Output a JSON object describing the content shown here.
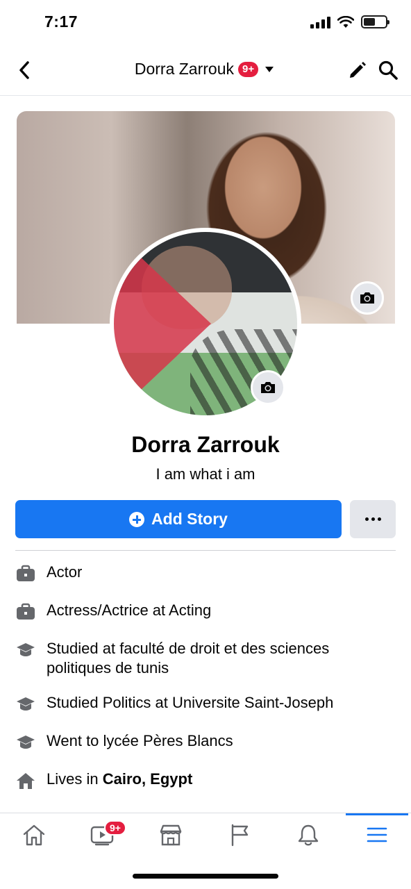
{
  "status_bar": {
    "time": "7:17"
  },
  "header": {
    "title": "Dorra Zarrouk",
    "badge": "9+"
  },
  "profile": {
    "name": "Dorra Zarrouk",
    "bio": "I am what i am"
  },
  "actions": {
    "add_story_label": "Add Story"
  },
  "details": [
    {
      "icon": "briefcase-icon",
      "text": "Actor"
    },
    {
      "icon": "briefcase-icon",
      "text": "Actress/Actrice at Acting"
    },
    {
      "icon": "graduation-cap-icon",
      "text_line1": "Studied at faculté de droit et des sciences",
      "text_line2": "politiques de tunis"
    },
    {
      "icon": "graduation-cap-icon",
      "text": "Studied Politics at Universite Saint-Joseph"
    },
    {
      "icon": "graduation-cap-icon",
      "text": "Went to lycée Pères Blancs"
    },
    {
      "icon": "house-icon",
      "prefix": "Lives in ",
      "place": "Cairo, Egypt"
    }
  ],
  "bottom_nav": {
    "items": [
      "home-icon",
      "watch-icon",
      "marketplace-icon",
      "pages-flag-icon",
      "notifications-bell-icon",
      "menu-icon"
    ],
    "watch_badge": "9+",
    "active": "menu-icon"
  },
  "colors": {
    "accent": "#1877f2",
    "badge": "#e41e3f",
    "icon_gray": "#65676b"
  }
}
